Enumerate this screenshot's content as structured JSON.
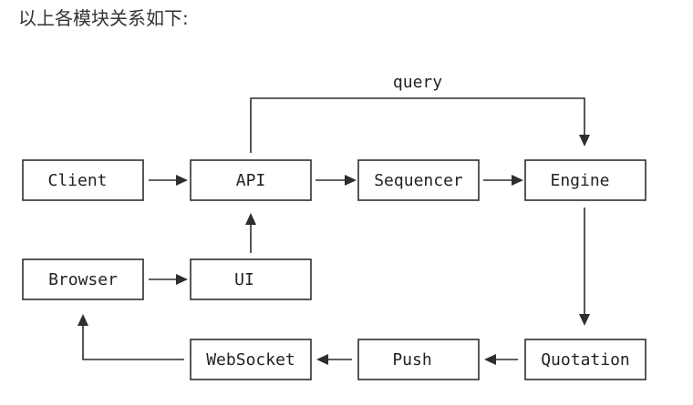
{
  "heading": "以上各模块关系如下:",
  "diagram": {
    "modules": {
      "client": "Client",
      "api": "API",
      "sequencer": "Sequencer",
      "engine": "Engine",
      "browser": "Browser",
      "ui": "UI",
      "websocket": "WebSocket",
      "push": "Push",
      "quotation": "Quotation"
    },
    "edge_labels": {
      "api_to_engine": "query"
    },
    "edges": [
      [
        "client",
        "api"
      ],
      [
        "api",
        "sequencer"
      ],
      [
        "sequencer",
        "engine"
      ],
      [
        "api",
        "engine"
      ],
      [
        "ui",
        "api"
      ],
      [
        "browser",
        "ui"
      ],
      [
        "engine",
        "quotation"
      ],
      [
        "quotation",
        "push"
      ],
      [
        "push",
        "websocket"
      ],
      [
        "websocket",
        "browser"
      ]
    ]
  }
}
